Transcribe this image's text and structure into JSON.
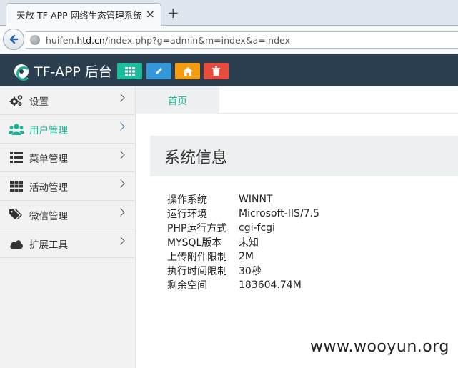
{
  "browser": {
    "tab_title": "天放 TF-APP 网络生态管理系统",
    "tab_close": "×",
    "new_tab": "+",
    "back_icon": "back-arrow-icon",
    "url_host_pre": "huifen.",
    "url_host_bold": "htd.cn",
    "url_path": "/index.php?g=admin&m=index&a=index"
  },
  "navbar": {
    "brand": "TF-APP 后台",
    "buttons": [
      {
        "icon": "grid-icon",
        "color": "#1bbc9b"
      },
      {
        "icon": "pencil-icon",
        "color": "#3498db"
      },
      {
        "icon": "home-icon",
        "color": "#f39c12"
      },
      {
        "icon": "trash-icon",
        "color": "#e74c3c"
      }
    ]
  },
  "sidebar": {
    "items": [
      {
        "label": "设置",
        "icon": "gears-icon",
        "active": false
      },
      {
        "label": "用户管理",
        "icon": "users-icon",
        "active": true
      },
      {
        "label": "菜单管理",
        "icon": "list-icon",
        "active": false
      },
      {
        "label": "活动管理",
        "icon": "grid-icon",
        "active": false
      },
      {
        "label": "微信管理",
        "icon": "tags-icon",
        "active": false
      },
      {
        "label": "扩展工具",
        "icon": "cloud-icon",
        "active": false
      }
    ]
  },
  "main": {
    "tab_label": "首页",
    "panel_title": "系统信息",
    "info_rows": [
      {
        "key": "操作系统",
        "value": "WINNT"
      },
      {
        "key": "运行环境",
        "value": "Microsoft-IIS/7.5"
      },
      {
        "key": "PHP运行方式",
        "value": "cgi-fcgi"
      },
      {
        "key": "MYSQL版本",
        "value": "未知"
      },
      {
        "key": "上传附件限制",
        "value": "2M"
      },
      {
        "key": "执行时间限制",
        "value": "30秒"
      },
      {
        "key": "剩余空间",
        "value": "183604.74M"
      }
    ]
  },
  "watermark": "www.wooyun.org",
  "colors": {
    "accent": "#1ab394",
    "navbar_bg": "#2b3e50"
  }
}
